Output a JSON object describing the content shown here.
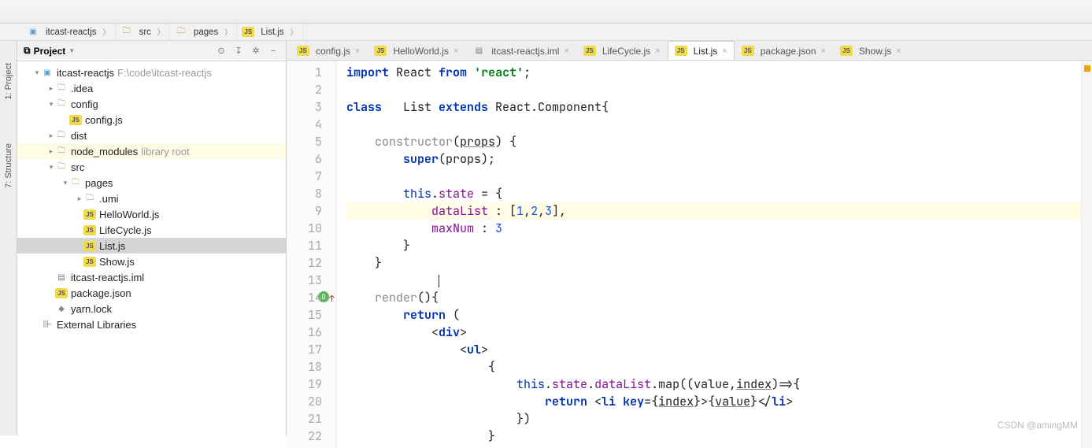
{
  "breadcrumbs": [
    {
      "icon": "proj",
      "label": "itcast-reactjs"
    },
    {
      "icon": "folder",
      "label": "src"
    },
    {
      "icon": "folder",
      "label": "pages"
    },
    {
      "icon": "js",
      "label": "List.js"
    }
  ],
  "verticalTabs": [
    {
      "label": "1: Project"
    },
    {
      "label": "7: Structure"
    }
  ],
  "projectPanel": {
    "title": "Project"
  },
  "tree": [
    {
      "depth": 0,
      "arrow": "▾",
      "icon": "proj",
      "label": "itcast-reactjs",
      "extra": "F:\\code\\itcast-reactjs"
    },
    {
      "depth": 1,
      "arrow": "▸",
      "icon": "folder-grey",
      "label": ".idea"
    },
    {
      "depth": 1,
      "arrow": "▾",
      "icon": "folder",
      "label": "config"
    },
    {
      "depth": 2,
      "arrow": "",
      "icon": "js",
      "label": "config.js"
    },
    {
      "depth": 1,
      "arrow": "▸",
      "icon": "folder-grey",
      "label": "dist"
    },
    {
      "depth": 1,
      "arrow": "▸",
      "icon": "folder-grey",
      "label": "node_modules",
      "extra": "library root",
      "lib": true
    },
    {
      "depth": 1,
      "arrow": "▾",
      "icon": "folder",
      "label": "src"
    },
    {
      "depth": 2,
      "arrow": "▾",
      "icon": "folder",
      "label": "pages"
    },
    {
      "depth": 3,
      "arrow": "▸",
      "icon": "folder-grey",
      "label": ".umi"
    },
    {
      "depth": 3,
      "arrow": "",
      "icon": "js",
      "label": "HelloWorld.js"
    },
    {
      "depth": 3,
      "arrow": "",
      "icon": "js",
      "label": "LifeCycle.js"
    },
    {
      "depth": 3,
      "arrow": "",
      "icon": "js",
      "label": "List.js",
      "selected": true
    },
    {
      "depth": 3,
      "arrow": "",
      "icon": "js",
      "label": "Show.js"
    },
    {
      "depth": 1,
      "arrow": "",
      "icon": "iml",
      "label": "itcast-reactjs.iml"
    },
    {
      "depth": 1,
      "arrow": "",
      "icon": "js",
      "label": "package.json"
    },
    {
      "depth": 1,
      "arrow": "",
      "icon": "lock",
      "label": "yarn.lock"
    },
    {
      "depth": 0,
      "arrow": "",
      "icon": "lib",
      "label": "External Libraries"
    }
  ],
  "editorTabs": [
    {
      "icon": "js",
      "label": "config.js",
      "active": false
    },
    {
      "icon": "js",
      "label": "HelloWorld.js",
      "active": false
    },
    {
      "icon": "iml",
      "label": "itcast-reactjs.iml",
      "active": false
    },
    {
      "icon": "js",
      "label": "LifeCycle.js",
      "active": false
    },
    {
      "icon": "js",
      "label": "List.js",
      "active": true
    },
    {
      "icon": "js",
      "label": "package.json",
      "active": false
    },
    {
      "icon": "js",
      "label": "Show.js",
      "active": false
    }
  ],
  "lineCount": 22,
  "highlightLine": 9,
  "overrideMarkerLine": 14,
  "code": {
    "l1": {
      "pre": "",
      "tokens": [
        [
          "k-blue",
          "import"
        ],
        [
          "",
          " React "
        ],
        [
          "k-blue",
          "from"
        ],
        [
          "",
          " "
        ],
        [
          "k-str",
          "'react'"
        ],
        [
          "",
          ";"
        ]
      ]
    },
    "l2": {
      "pre": "",
      "tokens": []
    },
    "l3": {
      "pre": "",
      "tokens": [
        [
          "k-blue",
          "class"
        ],
        [
          "",
          "   List "
        ],
        [
          "k-blue",
          "extends"
        ],
        [
          "",
          " React.Component{"
        ]
      ]
    },
    "l4": {
      "pre": "",
      "tokens": []
    },
    "l5": {
      "pre": "    ",
      "tokens": [
        [
          "k-grey",
          "constructor"
        ],
        [
          "",
          "("
        ],
        [
          "ul",
          "props"
        ],
        [
          "",
          ") {"
        ]
      ]
    },
    "l6": {
      "pre": "        ",
      "tokens": [
        [
          "k-blue",
          "super"
        ],
        [
          "",
          "(props);"
        ]
      ]
    },
    "l7": {
      "pre": "",
      "tokens": []
    },
    "l8": {
      "pre": "        ",
      "tokens": [
        [
          "k-this",
          "this"
        ],
        [
          "",
          "."
        ],
        [
          "k-purple",
          "state"
        ],
        [
          "",
          " = {"
        ]
      ]
    },
    "l9": {
      "pre": "            ",
      "tokens": [
        [
          "k-purple",
          "dataList"
        ],
        [
          "",
          " : ["
        ],
        [
          "k-num",
          "1"
        ],
        [
          "",
          ","
        ],
        [
          "k-num",
          "2"
        ],
        [
          "",
          ","
        ],
        [
          "k-num",
          "3"
        ],
        [
          "",
          "],"
        ]
      ]
    },
    "l10": {
      "pre": "            ",
      "tokens": [
        [
          "k-purple",
          "maxNum"
        ],
        [
          "",
          " : "
        ],
        [
          "k-num",
          "3"
        ]
      ]
    },
    "l11": {
      "pre": "        ",
      "tokens": [
        [
          "",
          "}"
        ]
      ]
    },
    "l12": {
      "pre": "    ",
      "tokens": [
        [
          "",
          "}"
        ]
      ]
    },
    "l13": {
      "pre": "",
      "tokens": []
    },
    "l14": {
      "pre": "    ",
      "tokens": [
        [
          "k-grey",
          "render"
        ],
        [
          "",
          "(){"
        ]
      ]
    },
    "l15": {
      "pre": "        ",
      "tokens": [
        [
          "k-blue",
          "return"
        ],
        [
          "",
          " ("
        ]
      ]
    },
    "l16": {
      "pre": "            ",
      "tokens": [
        [
          "",
          "<"
        ],
        [
          "k-blue",
          "div"
        ],
        [
          "",
          ">"
        ]
      ]
    },
    "l17": {
      "pre": "                ",
      "tokens": [
        [
          "",
          "<"
        ],
        [
          "k-blue",
          "ul"
        ],
        [
          "",
          ">"
        ]
      ]
    },
    "l18": {
      "pre": "                    ",
      "tokens": [
        [
          "",
          "{"
        ]
      ]
    },
    "l19": {
      "pre": "                        ",
      "tokens": [
        [
          "k-this",
          "this"
        ],
        [
          "",
          "."
        ],
        [
          "k-purple",
          "state"
        ],
        [
          "",
          "."
        ],
        [
          "k-purple",
          "dataList"
        ],
        [
          "",
          ".map((value,"
        ],
        [
          "ul",
          "index"
        ],
        [
          "",
          ")=>{"
        ]
      ]
    },
    "l20": {
      "pre": "                            ",
      "tokens": [
        [
          "k-blue",
          "return"
        ],
        [
          "",
          " <"
        ],
        [
          "k-blue",
          "li"
        ],
        [
          "",
          " "
        ],
        [
          "k-blue",
          "key"
        ],
        [
          "",
          "={"
        ],
        [
          "ul",
          "index"
        ],
        [
          "",
          "}>{"
        ],
        [
          "ul",
          "value"
        ],
        [
          "",
          "}</"
        ],
        [
          "k-blue",
          "li"
        ],
        [
          "",
          ">"
        ]
      ]
    },
    "l21": {
      "pre": "                        ",
      "tokens": [
        [
          "",
          "})"
        ]
      ]
    },
    "l22": {
      "pre": "                    ",
      "tokens": [
        [
          "",
          "}"
        ]
      ]
    }
  },
  "watermark": "CSDN @amingMM"
}
